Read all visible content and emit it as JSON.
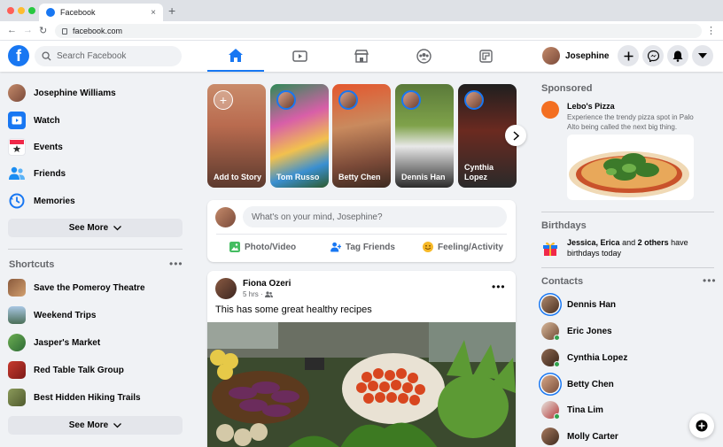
{
  "browser": {
    "tab_title": "Facebook",
    "url": "facebook.com",
    "tab_close": "×",
    "new_tab": "+"
  },
  "header": {
    "search_placeholder": "Search Facebook",
    "profile_name": "Josephine",
    "nav_tabs": [
      "home-icon",
      "watch-icon",
      "marketplace-icon",
      "groups-icon",
      "gaming-icon"
    ],
    "accent": "#1877f2"
  },
  "left": {
    "profile_name": "Josephine Williams",
    "items": [
      {
        "label": "Watch",
        "icon": "watch-icon"
      },
      {
        "label": "Events",
        "icon": "events-icon"
      },
      {
        "label": "Friends",
        "icon": "friends-icon"
      },
      {
        "label": "Memories",
        "icon": "memories-icon"
      }
    ],
    "see_more": "See More",
    "shortcuts_title": "Shortcuts",
    "shortcuts": [
      "Save the Pomeroy Theatre",
      "Weekend Trips",
      "Jasper's Market",
      "Red Table Talk Group",
      "Best Hidden Hiking Trails"
    ],
    "see_more_2": "See More"
  },
  "stories": [
    {
      "name": "Add to Story"
    },
    {
      "name": "Tom Russo"
    },
    {
      "name": "Betty Chen"
    },
    {
      "name": "Dennis Han"
    },
    {
      "name": "Cynthia Lopez"
    }
  ],
  "composer": {
    "placeholder": "What's on your mind, Josephine?",
    "actions": [
      "Photo/Video",
      "Tag Friends",
      "Feeling/Activity"
    ]
  },
  "post": {
    "author": "Fiona Ozeri",
    "time": "5 hrs",
    "text": "This has some great healthy recipes"
  },
  "right": {
    "sponsored_title": "Sponsored",
    "ad_name": "Lebo's Pizza",
    "ad_text": "Experience the trendy pizza spot in Palo Alto being called the next big thing.",
    "birthdays_title": "Birthdays",
    "birthday_names": "Jessica, Erica",
    "birthday_and": "and",
    "birthday_others": "2 others",
    "birthday_have": "have",
    "birthday_tail": "birthdays today",
    "contacts_title": "Contacts",
    "contacts": [
      {
        "name": "Dennis Han",
        "story": true,
        "online": false
      },
      {
        "name": "Eric Jones",
        "story": false,
        "online": true
      },
      {
        "name": "Cynthia Lopez",
        "story": false,
        "online": true
      },
      {
        "name": "Betty Chen",
        "story": true,
        "online": false
      },
      {
        "name": "Tina Lim",
        "story": false,
        "online": true
      },
      {
        "name": "Molly Carter",
        "story": false,
        "online": false
      }
    ]
  }
}
